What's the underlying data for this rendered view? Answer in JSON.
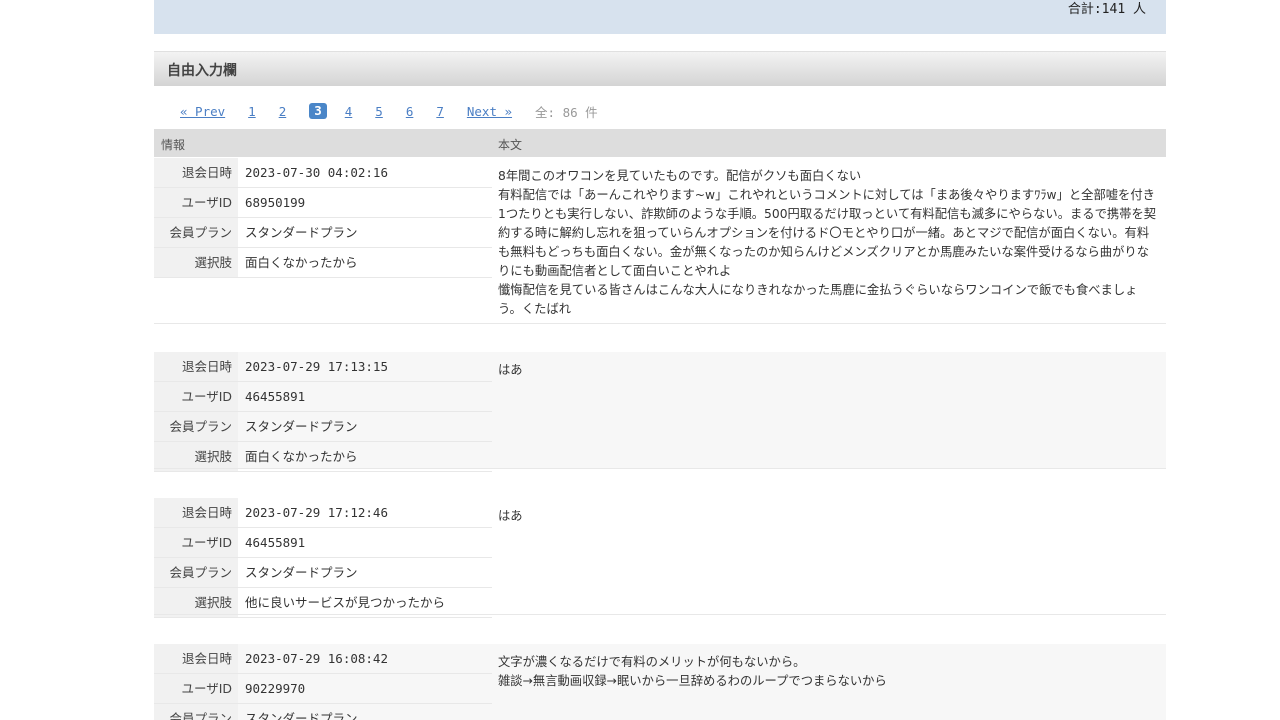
{
  "header": {
    "total": "合計:141 人"
  },
  "section": {
    "title": "自由入力欄"
  },
  "pagination": {
    "prev": "« Prev",
    "pages": [
      "1",
      "2",
      "3",
      "4",
      "5",
      "6",
      "7"
    ],
    "current": "3",
    "next": "Next »",
    "count": "全: 86 件"
  },
  "table": {
    "col_info": "情報",
    "col_body": "本文"
  },
  "labels": {
    "date": "退会日時",
    "user": "ユーザID",
    "plan": "会員プラン",
    "choice": "選択肢"
  },
  "entries": [
    {
      "date": "2023-07-30 04:02:16",
      "user": "68950199",
      "plan": "スタンダードプラン",
      "choice": "面白くなかったから",
      "body": "8年間このオワコンを見ていたものです。配信がクソも面白くない\n有料配信では「あーんこれやります~w」これやれというコメントに対しては「まあ後々やりますﾜﾗw」と全部嘘を付き1つたりとも実行しない、詐欺師のような手順。500円取るだけ取っといて有料配信も滅多にやらない。まるで携帯を契約する時に解約し忘れを狙っていらんオプションを付けるド〇モとやり口が一緒。あとマジで配信が面白くない。有料も無料もどっちも面白くない。金が無くなったのか知らんけどメンズクリアとか馬鹿みたいな案件受けるなら曲がりなりにも動画配信者として面白いことやれよ\n懺悔配信を見ている皆さんはこんな大人になりきれなかった馬鹿に金払うぐらいならワンコインで飯でも食べましょう。くたばれ"
    },
    {
      "date": "2023-07-29 17:13:15",
      "user": "46455891",
      "plan": "スタンダードプラン",
      "choice": "面白くなかったから",
      "body": "はあ"
    },
    {
      "date": "2023-07-29 17:12:46",
      "user": "46455891",
      "plan": "スタンダードプラン",
      "choice": "他に良いサービスが見つかったから",
      "body": "はあ"
    },
    {
      "date": "2023-07-29 16:08:42",
      "user": "90229970",
      "plan": "スタンダードプラン",
      "choice": "",
      "body": "文字が濃くなるだけで有料のメリットが何もないから。\n雑談→無言動画収録→眠いから一旦辞めるわのループでつまらないから"
    }
  ]
}
